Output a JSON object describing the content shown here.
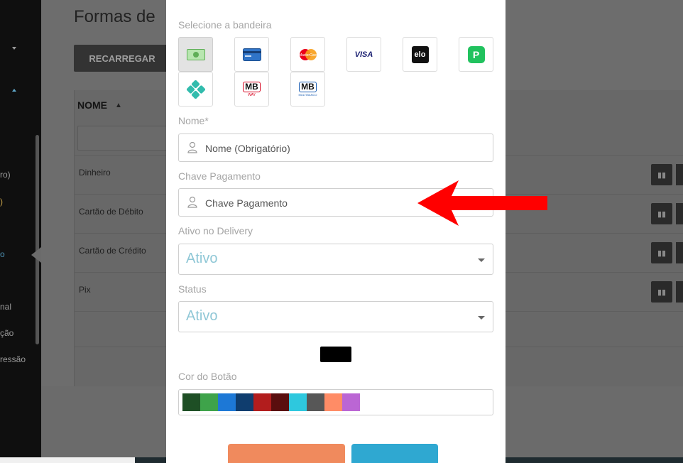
{
  "background": {
    "page_title": "Formas de",
    "reload_button": "RECARREGAR",
    "table_header_name": "NOME",
    "rows": [
      "Dinheiro",
      "Cartão de Débito",
      "Cartão de Crédito",
      "Pix"
    ],
    "sidebar_fragments": [
      "ro)",
      "o",
      "nal",
      "ção",
      "ressão"
    ]
  },
  "modal": {
    "flags_label": "Selecione a bandeira",
    "flags": [
      {
        "name": "dinheiro",
        "selected": true
      },
      {
        "name": "cartao-generico"
      },
      {
        "name": "mastercard",
        "text": "MasterCard"
      },
      {
        "name": "visa",
        "text": "VISA"
      },
      {
        "name": "elo",
        "text": "elo"
      },
      {
        "name": "picpay",
        "text": "P"
      },
      {
        "name": "pix"
      },
      {
        "name": "mbway",
        "text": "MB",
        "sub": "WAY"
      },
      {
        "name": "multibanco",
        "text": "MB",
        "sub": "MULTIBANCO"
      }
    ],
    "name_label": "Nome*",
    "name_placeholder": "Nome (Obrigatório)",
    "key_label": "Chave Pagamento",
    "key_placeholder": "Chave Pagamento",
    "delivery_label": "Ativo no Delivery",
    "delivery_value": "Ativo",
    "status_label": "Status",
    "status_value": "Ativo",
    "button_color_label": "Cor do Botão",
    "selected_color": "#000000",
    "palette": [
      "#1e4f25",
      "#3ea34a",
      "#1d78d6",
      "#0f3d6e",
      "#b21d1d",
      "#5a0e0e",
      "#2ec8de",
      "#575757",
      "#ff8c66",
      "#bb66d4"
    ]
  },
  "colors": {
    "accent_cancel": "#f08a5d",
    "accent_save": "#2fa8d1",
    "arrow": "#ff0000"
  }
}
